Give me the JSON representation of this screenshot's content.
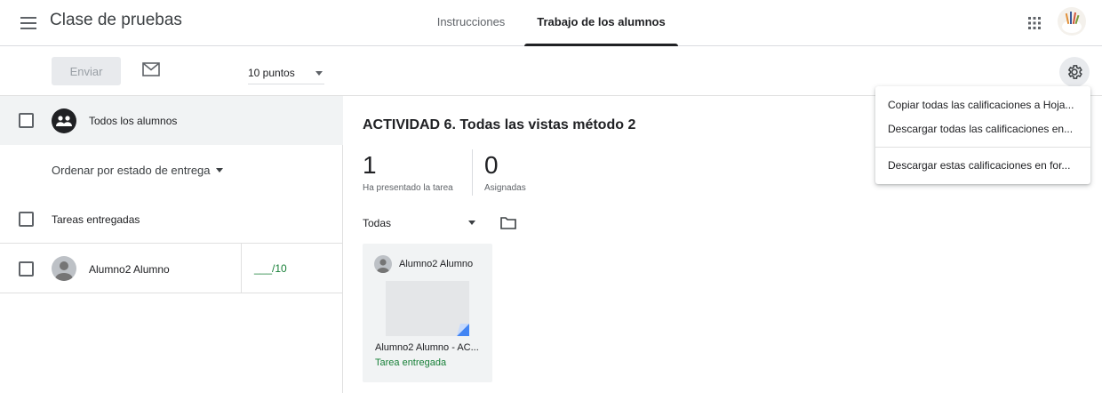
{
  "header": {
    "title": "Clase de pruebas",
    "tabs": [
      {
        "label": "Instrucciones",
        "active": false
      },
      {
        "label": "Trabajo de los alumnos",
        "active": true
      }
    ],
    "icons": [
      "menu-icon",
      "apps-grid-icon",
      "user-avatar"
    ]
  },
  "toolbar": {
    "send_label": "Enviar",
    "points_value": "10 puntos"
  },
  "left_panel": {
    "all_students_label": "Todos los alumnos",
    "sort_label": "Ordenar por estado de entrega",
    "section_turned_in": "Tareas entregadas",
    "students": [
      {
        "name": "Alumno2 Alumno",
        "grade": "___/10"
      }
    ]
  },
  "main": {
    "activity_title": "ACTIVIDAD 6. Todas las vistas método 2",
    "stats": [
      {
        "value": "1",
        "label": "Ha presentado la tarea"
      },
      {
        "value": "0",
        "label": "Asignadas"
      }
    ],
    "filter_label": "Todas",
    "card": {
      "student_name": "Alumno2 Alumno",
      "file_name": "Alumno2 Alumno - AC...",
      "status": "Tarea entregada"
    }
  },
  "menu": {
    "items": [
      "Copiar todas las calificaciones a Hoja...",
      "Descargar todas las calificaciones en...",
      "Descargar estas calificaciones en for..."
    ]
  },
  "colors": {
    "accent_green": "#188038",
    "text_primary": "#202124",
    "text_secondary": "#5f6368",
    "row_highlight": "#f1f3f4"
  }
}
